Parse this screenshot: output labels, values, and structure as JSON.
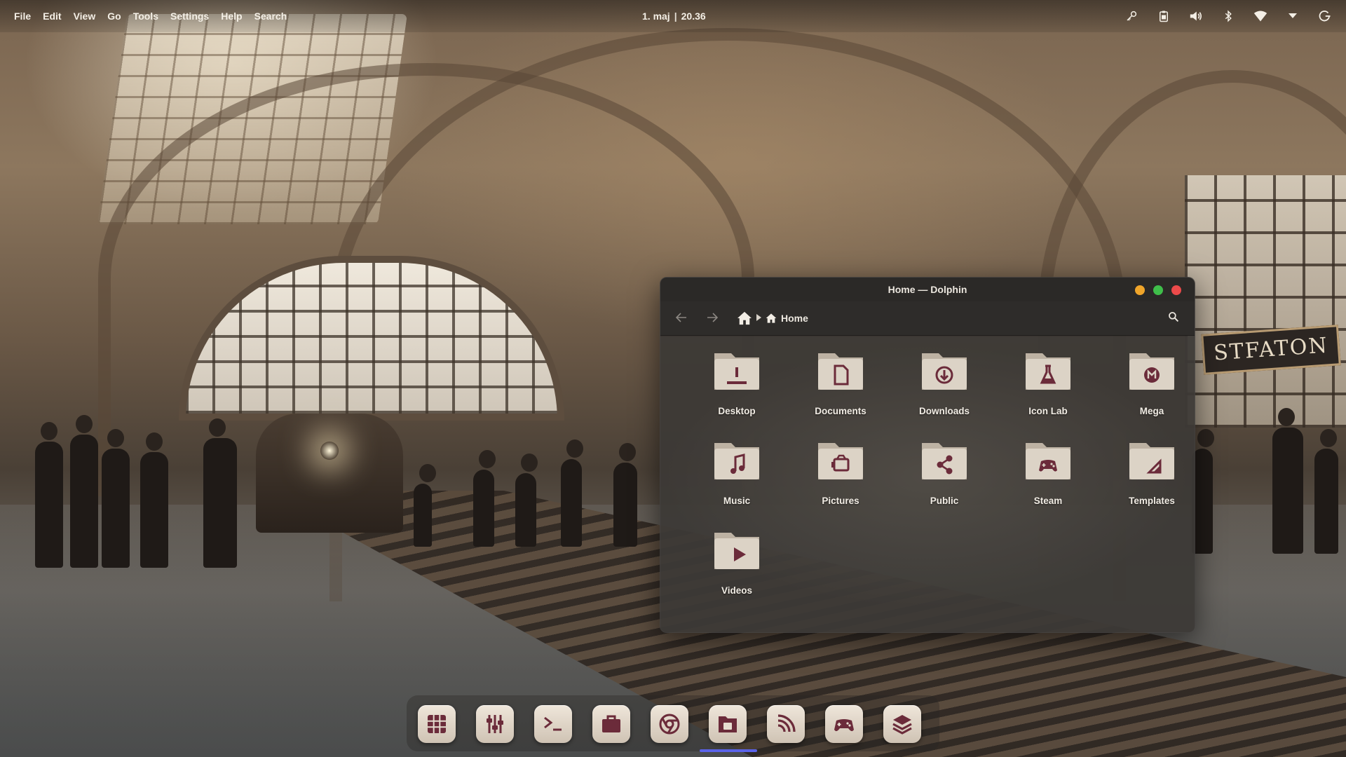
{
  "topbar": {
    "menu": [
      "File",
      "Edit",
      "View",
      "Go",
      "Tools",
      "Settings",
      "Help",
      "Search"
    ],
    "date": "1. maj",
    "separator": "|",
    "time": "20.36",
    "tray_icons": [
      "key-icon",
      "clipboard-icon",
      "volume-icon",
      "bluetooth-icon",
      "wifi-icon",
      "chevron-down-icon",
      "power-icon"
    ]
  },
  "wallpaper": {
    "sign_text": "STFATON"
  },
  "window": {
    "title": "Home — Dolphin",
    "breadcrumb": {
      "location": "Home"
    },
    "items": [
      {
        "label": "Desktop",
        "icon": "desktop-icon"
      },
      {
        "label": "Documents",
        "icon": "document-icon"
      },
      {
        "label": "Downloads",
        "icon": "download-icon"
      },
      {
        "label": "Icon Lab",
        "icon": "flask-icon"
      },
      {
        "label": "Mega",
        "icon": "mega-icon"
      },
      {
        "label": "Music",
        "icon": "music-note-icon"
      },
      {
        "label": "Pictures",
        "icon": "picture-icon"
      },
      {
        "label": "Public",
        "icon": "share-icon"
      },
      {
        "label": "Steam",
        "icon": "gamepad-icon"
      },
      {
        "label": "Templates",
        "icon": "template-icon"
      },
      {
        "label": "Videos",
        "icon": "play-icon"
      }
    ]
  },
  "dock": {
    "items": [
      "app-grid-icon",
      "mixer-icon",
      "terminal-icon",
      "briefcase-icon",
      "chrome-icon",
      "file-manager-icon",
      "rss-icon",
      "gamepad-icon",
      "layers-icon"
    ],
    "active": "file-manager-icon"
  },
  "colors": {
    "folder_body": "#d8cfc2",
    "folder_glyph": "#6b2b3a",
    "dock_indicator": "#5a63e8",
    "window_close": "#ec4a4a",
    "window_minimize": "#f0a52a",
    "window_maximize": "#3fbe4a"
  }
}
